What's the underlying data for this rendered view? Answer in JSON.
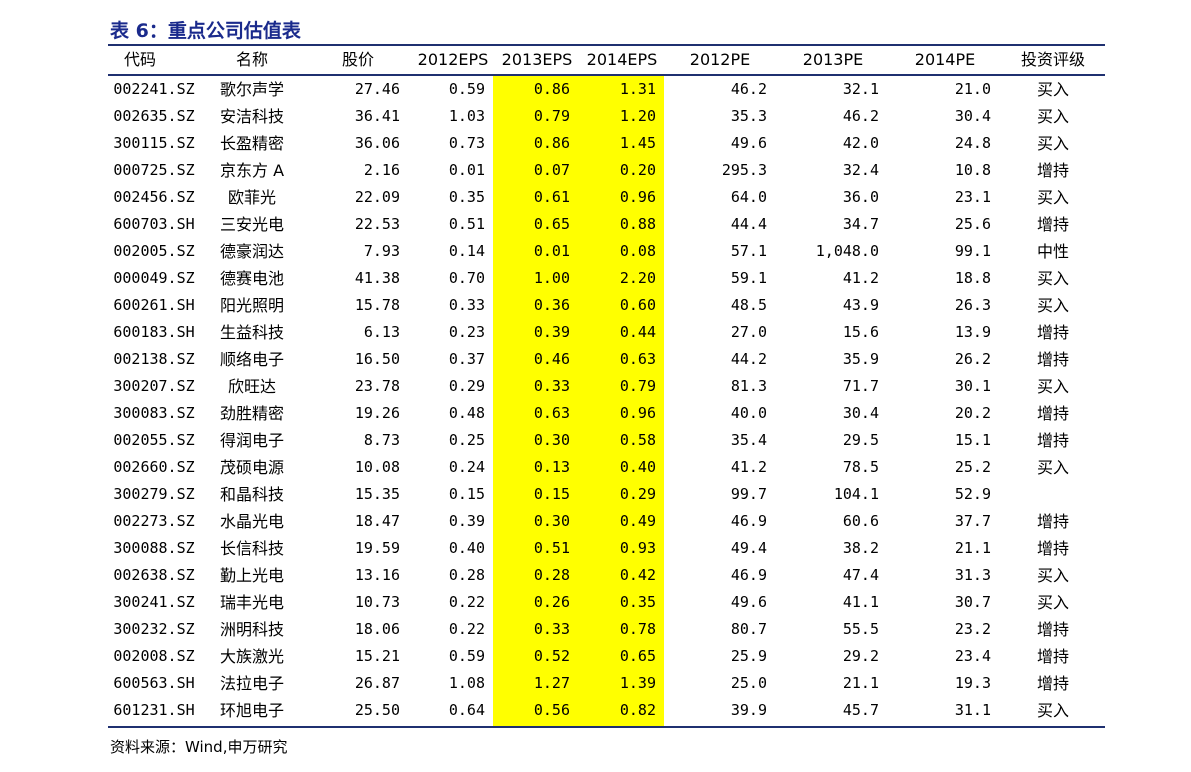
{
  "title": "表 6：重点公司估值表",
  "headers": {
    "code": "代码",
    "name": "名称",
    "price": "股价",
    "eps2012": "2012EPS",
    "eps2013": "2013EPS",
    "eps2014": "2014EPS",
    "pe2012": "2012PE",
    "pe2013": "2013PE",
    "pe2014": "2014PE",
    "rating": "投资评级"
  },
  "highlight_color": "#ffff00",
  "title_color": "#1a2a8c",
  "rows": [
    {
      "code": "002241.SZ",
      "name": "歌尔声学",
      "price": "27.46",
      "eps2012": "0.59",
      "eps2013": "0.86",
      "eps2014": "1.31",
      "pe2012": "46.2",
      "pe2013": "32.1",
      "pe2014": "21.0",
      "rating": "买入"
    },
    {
      "code": "002635.SZ",
      "name": "安洁科技",
      "price": "36.41",
      "eps2012": "1.03",
      "eps2013": "0.79",
      "eps2014": "1.20",
      "pe2012": "35.3",
      "pe2013": "46.2",
      "pe2014": "30.4",
      "rating": "买入"
    },
    {
      "code": "300115.SZ",
      "name": "长盈精密",
      "price": "36.06",
      "eps2012": "0.73",
      "eps2013": "0.86",
      "eps2014": "1.45",
      "pe2012": "49.6",
      "pe2013": "42.0",
      "pe2014": "24.8",
      "rating": "买入"
    },
    {
      "code": "000725.SZ",
      "name": "京东方 A",
      "price": "2.16",
      "eps2012": "0.01",
      "eps2013": "0.07",
      "eps2014": "0.20",
      "pe2012": "295.3",
      "pe2013": "32.4",
      "pe2014": "10.8",
      "rating": "增持"
    },
    {
      "code": "002456.SZ",
      "name": "欧菲光",
      "price": "22.09",
      "eps2012": "0.35",
      "eps2013": "0.61",
      "eps2014": "0.96",
      "pe2012": "64.0",
      "pe2013": "36.0",
      "pe2014": "23.1",
      "rating": "买入"
    },
    {
      "code": "600703.SH",
      "name": "三安光电",
      "price": "22.53",
      "eps2012": "0.51",
      "eps2013": "0.65",
      "eps2014": "0.88",
      "pe2012": "44.4",
      "pe2013": "34.7",
      "pe2014": "25.6",
      "rating": "增持"
    },
    {
      "code": "002005.SZ",
      "name": "德豪润达",
      "price": "7.93",
      "eps2012": "0.14",
      "eps2013": "0.01",
      "eps2014": "0.08",
      "pe2012": "57.1",
      "pe2013": "1,048.0",
      "pe2014": "99.1",
      "rating": "中性"
    },
    {
      "code": "000049.SZ",
      "name": "德赛电池",
      "price": "41.38",
      "eps2012": "0.70",
      "eps2013": "1.00",
      "eps2014": "2.20",
      "pe2012": "59.1",
      "pe2013": "41.2",
      "pe2014": "18.8",
      "rating": "买入"
    },
    {
      "code": "600261.SH",
      "name": "阳光照明",
      "price": "15.78",
      "eps2012": "0.33",
      "eps2013": "0.36",
      "eps2014": "0.60",
      "pe2012": "48.5",
      "pe2013": "43.9",
      "pe2014": "26.3",
      "rating": "买入"
    },
    {
      "code": "600183.SH",
      "name": "生益科技",
      "price": "6.13",
      "eps2012": "0.23",
      "eps2013": "0.39",
      "eps2014": "0.44",
      "pe2012": "27.0",
      "pe2013": "15.6",
      "pe2014": "13.9",
      "rating": "增持"
    },
    {
      "code": "002138.SZ",
      "name": "顺络电子",
      "price": "16.50",
      "eps2012": "0.37",
      "eps2013": "0.46",
      "eps2014": "0.63",
      "pe2012": "44.2",
      "pe2013": "35.9",
      "pe2014": "26.2",
      "rating": "增持"
    },
    {
      "code": "300207.SZ",
      "name": "欣旺达",
      "price": "23.78",
      "eps2012": "0.29",
      "eps2013": "0.33",
      "eps2014": "0.79",
      "pe2012": "81.3",
      "pe2013": "71.7",
      "pe2014": "30.1",
      "rating": "买入"
    },
    {
      "code": "300083.SZ",
      "name": "劲胜精密",
      "price": "19.26",
      "eps2012": "0.48",
      "eps2013": "0.63",
      "eps2014": "0.96",
      "pe2012": "40.0",
      "pe2013": "30.4",
      "pe2014": "20.2",
      "rating": "增持"
    },
    {
      "code": "002055.SZ",
      "name": "得润电子",
      "price": "8.73",
      "eps2012": "0.25",
      "eps2013": "0.30",
      "eps2014": "0.58",
      "pe2012": "35.4",
      "pe2013": "29.5",
      "pe2014": "15.1",
      "rating": "增持"
    },
    {
      "code": "002660.SZ",
      "name": "茂硕电源",
      "price": "10.08",
      "eps2012": "0.24",
      "eps2013": "0.13",
      "eps2014": "0.40",
      "pe2012": "41.2",
      "pe2013": "78.5",
      "pe2014": "25.2",
      "rating": "买入"
    },
    {
      "code": "300279.SZ",
      "name": "和晶科技",
      "price": "15.35",
      "eps2012": "0.15",
      "eps2013": "0.15",
      "eps2014": "0.29",
      "pe2012": "99.7",
      "pe2013": "104.1",
      "pe2014": "52.9",
      "rating": ""
    },
    {
      "code": "002273.SZ",
      "name": "水晶光电",
      "price": "18.47",
      "eps2012": "0.39",
      "eps2013": "0.30",
      "eps2014": "0.49",
      "pe2012": "46.9",
      "pe2013": "60.6",
      "pe2014": "37.7",
      "rating": "增持"
    },
    {
      "code": "300088.SZ",
      "name": "长信科技",
      "price": "19.59",
      "eps2012": "0.40",
      "eps2013": "0.51",
      "eps2014": "0.93",
      "pe2012": "49.4",
      "pe2013": "38.2",
      "pe2014": "21.1",
      "rating": "增持"
    },
    {
      "code": "002638.SZ",
      "name": "勤上光电",
      "price": "13.16",
      "eps2012": "0.28",
      "eps2013": "0.28",
      "eps2014": "0.42",
      "pe2012": "46.9",
      "pe2013": "47.4",
      "pe2014": "31.3",
      "rating": "买入"
    },
    {
      "code": "300241.SZ",
      "name": "瑞丰光电",
      "price": "10.73",
      "eps2012": "0.22",
      "eps2013": "0.26",
      "eps2014": "0.35",
      "pe2012": "49.6",
      "pe2013": "41.1",
      "pe2014": "30.7",
      "rating": "买入"
    },
    {
      "code": "300232.SZ",
      "name": "洲明科技",
      "price": "18.06",
      "eps2012": "0.22",
      "eps2013": "0.33",
      "eps2014": "0.78",
      "pe2012": "80.7",
      "pe2013": "55.5",
      "pe2014": "23.2",
      "rating": "增持"
    },
    {
      "code": "002008.SZ",
      "name": "大族激光",
      "price": "15.21",
      "eps2012": "0.59",
      "eps2013": "0.52",
      "eps2014": "0.65",
      "pe2012": "25.9",
      "pe2013": "29.2",
      "pe2014": "23.4",
      "rating": "增持"
    },
    {
      "code": "600563.SH",
      "name": "法拉电子",
      "price": "26.87",
      "eps2012": "1.08",
      "eps2013": "1.27",
      "eps2014": "1.39",
      "pe2012": "25.0",
      "pe2013": "21.1",
      "pe2014": "19.3",
      "rating": "增持"
    },
    {
      "code": "601231.SH",
      "name": "环旭电子",
      "price": "25.50",
      "eps2012": "0.64",
      "eps2013": "0.56",
      "eps2014": "0.82",
      "pe2012": "39.9",
      "pe2013": "45.7",
      "pe2014": "31.1",
      "rating": "买入"
    }
  ],
  "source": "资料来源：Wind,申万研究"
}
